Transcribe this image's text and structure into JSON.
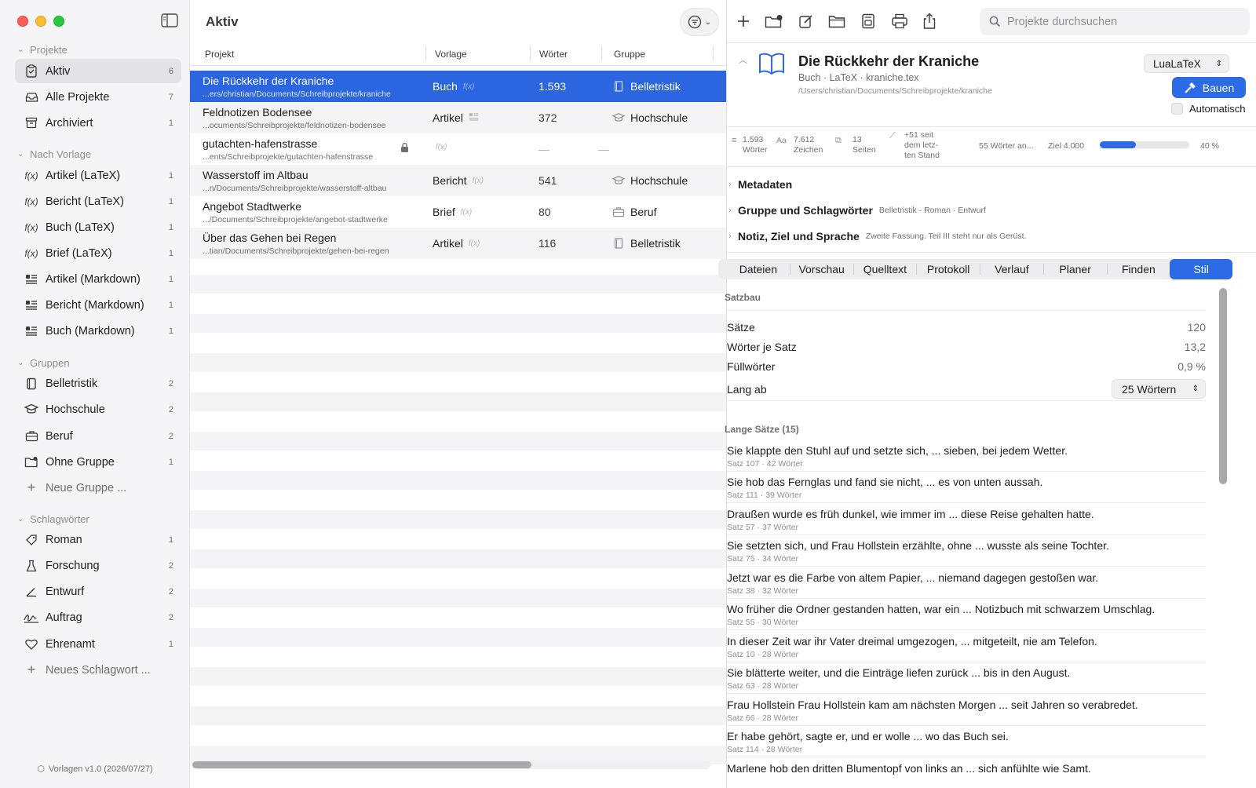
{
  "sidebar": {
    "sections": {
      "projekte": "Projekte",
      "vorlage": "Nach Vorlage",
      "gruppen": "Gruppen",
      "tags": "Schlagwörter"
    },
    "projekte": [
      {
        "label": "Aktiv",
        "count": "6"
      },
      {
        "label": "Alle Projekte",
        "count": "7"
      },
      {
        "label": "Archiviert",
        "count": "1"
      }
    ],
    "vorlagen": [
      {
        "label": "Artikel (LaTeX)",
        "count": "1"
      },
      {
        "label": "Bericht (LaTeX)",
        "count": "1"
      },
      {
        "label": "Buch (LaTeX)",
        "count": "1"
      },
      {
        "label": "Brief (LaTeX)",
        "count": "1"
      },
      {
        "label": "Artikel (Markdown)",
        "count": "1"
      },
      {
        "label": "Bericht (Markdown)",
        "count": "1"
      },
      {
        "label": "Buch (Markdown)",
        "count": "1"
      }
    ],
    "gruppen": [
      {
        "label": "Belletristik",
        "count": "2"
      },
      {
        "label": "Hochschule",
        "count": "2"
      },
      {
        "label": "Beruf",
        "count": "2"
      },
      {
        "label": "Ohne Gruppe",
        "count": "1"
      }
    ],
    "new_group": "Neue Gruppe ...",
    "tags": [
      {
        "label": "Roman",
        "count": "1"
      },
      {
        "label": "Forschung",
        "count": "2"
      },
      {
        "label": "Entwurf",
        "count": "2"
      },
      {
        "label": "Auftrag",
        "count": "2"
      },
      {
        "label": "Ehrenamt",
        "count": "1"
      }
    ],
    "new_tag": "Neues Schlagwort ...",
    "footer": "Vorlagen v1.0 (2026/07/27)"
  },
  "list": {
    "title": "Aktiv",
    "columns": {
      "projekt": "Projekt",
      "vorlage": "Vorlage",
      "woerter": "Wörter",
      "gruppe": "Gruppe"
    },
    "rows": [
      {
        "name": "Die Rückkehr der Kraniche",
        "path": "...ers/christian/Documents/Schreibprojekte/kraniche",
        "vorlage": "Buch",
        "fx": "f(x)",
        "words": "1.593",
        "group": "Belletristik"
      },
      {
        "name": "Feldnotizen Bodensee",
        "path": "...ocuments/Schreibprojekte/feldnotizen-bodensee",
        "vorlage": "Artikel",
        "fx": "",
        "words": "372",
        "group": "Hochschule"
      },
      {
        "name": "gutachten-hafenstrasse",
        "path": "...ents/Schreibprojekte/gutachten-hafenstrasse",
        "vorlage": "",
        "fx": "f(x)",
        "words": "—",
        "group": "—"
      },
      {
        "name": "Wasserstoff im Altbau",
        "path": "...n/Documents/Schreibprojekte/wasserstoff-altbau",
        "vorlage": "Bericht",
        "fx": "f(x)",
        "words": "541",
        "group": "Hochschule"
      },
      {
        "name": "Angebot Stadtwerke",
        "path": ".../Documents/Schreibprojekte/angebot-stadtwerke",
        "vorlage": "Brief",
        "fx": "f(x)",
        "words": "80",
        "group": "Beruf"
      },
      {
        "name": "Über das Gehen bei Regen",
        "path": "...tian/Documents/Schreibprojekte/gehen-bei-regen",
        "vorlage": "Artikel",
        "fx": "f(x)",
        "words": "116",
        "group": "Belletristik"
      }
    ]
  },
  "toolbar": {
    "search_placeholder": "Projekte durchsuchen"
  },
  "project": {
    "title": "Die Rückkehr der Kraniche",
    "subtitle": "Buch · LaTeX · kraniche.tex",
    "path": "/Users/christian/Documents/Schreibprojekte/kraniche",
    "engine": "LuaLaTeX",
    "build_label": "Bauen",
    "auto_label": "Automatisch"
  },
  "stats": {
    "words_val": "1.593",
    "words_lbl": "Wörter",
    "chars_val": "7.612",
    "chars_lbl": "Zeichen",
    "pages_val": "13",
    "pages_lbl": "Seiten",
    "delta_1": "+51 seit",
    "delta_2": "dem letz-",
    "delta_3": "ten Stand",
    "today": "55 Wörter an...",
    "goal": "Ziel 4.000",
    "goal_progress": 0.4,
    "goal_pct": "40 %"
  },
  "sections": [
    {
      "label": "Metadaten",
      "value": ""
    },
    {
      "label": "Gruppe und Schlagwörter",
      "value": "Belletristik · Roman · Entwurf"
    },
    {
      "label": "Notiz, Ziel und Sprache",
      "value": "Zweite Fassung. Teil III steht nur als Gerüst."
    }
  ],
  "tabs": [
    "Dateien",
    "Vorschau",
    "Quelltext",
    "Protokoll",
    "Verlauf",
    "Planer",
    "Finden",
    "Stil"
  ],
  "satzbau": {
    "heading": "Satzbau",
    "rows": [
      {
        "k": "Sätze",
        "v": "120"
      },
      {
        "k": "Wörter je Satz",
        "v": "13,2"
      },
      {
        "k": "Füllwörter",
        "v": "0,9 %"
      }
    ],
    "lang_label": "Lang ab",
    "lang_value": "25 Wörtern"
  },
  "long": {
    "heading": "Lange Sätze (15)",
    "items": [
      {
        "t": "Sie klappte den Stuhl auf und setzte sich, ... sieben, bei jedem Wetter.",
        "m": "Satz 107 · 42 Wörter"
      },
      {
        "t": "Sie hob das Fernglas und fand sie nicht, ... es von unten aussah.",
        "m": "Satz 111 · 39 Wörter"
      },
      {
        "t": "Draußen wurde es früh dunkel, wie immer im ... diese Reise gehalten hatte.",
        "m": "Satz 57 · 37 Wörter"
      },
      {
        "t": "Sie setzten sich, und Frau Hollstein erzählte, ohne ... wusste als seine Tochter.",
        "m": "Satz 75 · 34 Wörter"
      },
      {
        "t": "Jetzt war es die Farbe von altem Papier, ... niemand dagegen gestoßen war.",
        "m": "Satz 38 · 32 Wörter"
      },
      {
        "t": "Wo früher die Ordner gestanden hatten, war ein ... Notizbuch mit schwarzem Umschlag.",
        "m": "Satz 55 · 30 Wörter"
      },
      {
        "t": "In dieser Zeit war ihr Vater dreimal umgezogen, ... mitgeteilt, nie am Telefon.",
        "m": "Satz 10 · 28 Wörter"
      },
      {
        "t": "Sie blätterte weiter, und die Einträge liefen zurück ... bis in den August.",
        "m": "Satz 63 · 28 Wörter"
      },
      {
        "t": "Frau Hollstein Frau Hollstein kam am nächsten Morgen ... seit Jahren so verabredet.",
        "m": "Satz 66 · 28 Wörter"
      },
      {
        "t": "Er habe gehört, sagte er, und er wolle ... wo das Buch sei.",
        "m": "Satz 114 · 28 Wörter"
      },
      {
        "t": "Marlene hob den dritten Blumentopf von links an ... sich anfühlte wie Samt.",
        "m": ""
      }
    ]
  }
}
